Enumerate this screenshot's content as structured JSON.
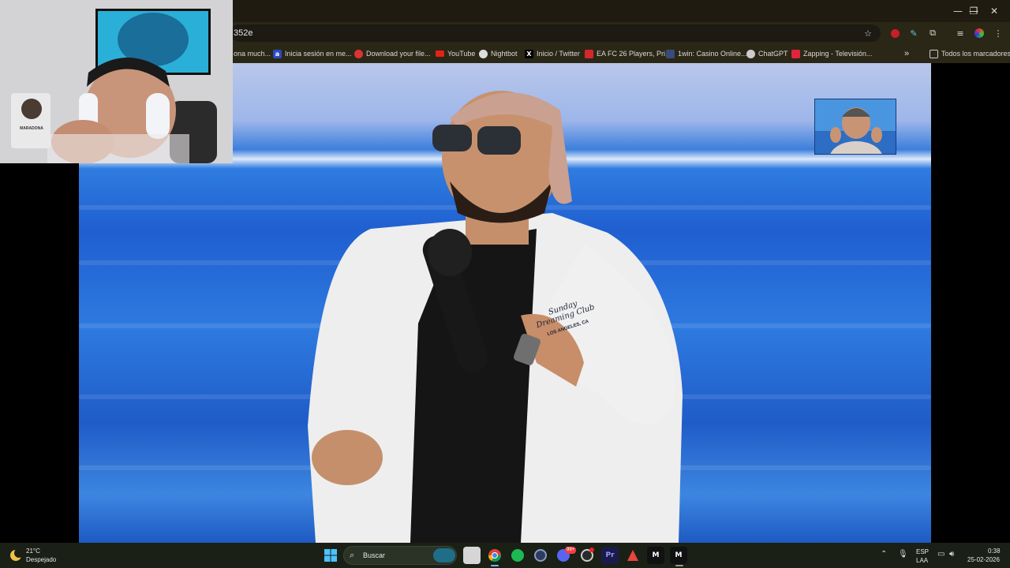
{
  "window": {
    "minimize_glyph": "—",
    "restore_glyph": "❐",
    "close_glyph": "✕"
  },
  "omnibox": {
    "url_visible": "352e",
    "icons": [
      "star-icon",
      "extension-icon",
      "profile-icon",
      "menu-icon"
    ]
  },
  "bookmarks": {
    "items": [
      {
        "label": "ona much..."
      },
      {
        "label": "Inicia sesión en me..."
      },
      {
        "label": "Download your file..."
      },
      {
        "label": "YouTube"
      },
      {
        "label": "Nightbot"
      },
      {
        "label": "Inicio / Twitter"
      },
      {
        "label": "EA FC 26 Players, Pri..."
      },
      {
        "label": "1win: Casino Online..."
      },
      {
        "label": "ChatGPT"
      },
      {
        "label": "Zapping - Televisión..."
      }
    ],
    "overflow_glyph": "»",
    "all_bookmarks_label": "Todos los marcadores",
    "colors": {
      "youtube": "#e62117",
      "download": "#d33",
      "ea": "#d4282c",
      "zapping": "#e0243a"
    }
  },
  "video": {
    "shirt_text": "Sunday Dreaming Club",
    "shirt_subtext": "LOS ANGELES, CA"
  },
  "webcam": {
    "card_text": "MARADONA"
  },
  "taskbar": {
    "weather_temp": "21°C",
    "weather_desc": "Despejado",
    "search_placeholder": "Buscar",
    "lang_line1": "ESP",
    "lang_line2": "LAA",
    "time": "0:38",
    "date": "25-02-2026",
    "discord_badge": "99+"
  }
}
